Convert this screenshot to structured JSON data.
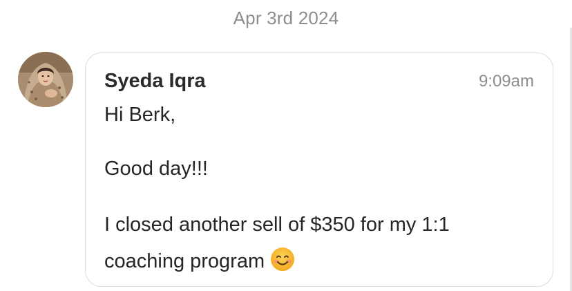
{
  "date_divider": "Apr 3rd 2024",
  "message": {
    "sender": "Syeda Iqra",
    "time": "9:09am",
    "greeting": "Hi Berk,",
    "line2": "Good day!!!",
    "line3a": "I closed another sell of $350 for my 1:1",
    "line3b": "coaching program",
    "emoji": "smiling-face-emoji"
  },
  "colors": {
    "timestamp": "#8d8d8d",
    "bubble_border": "#dcdcdc",
    "text": "#262626",
    "emoji_face": "#f7b92f"
  }
}
